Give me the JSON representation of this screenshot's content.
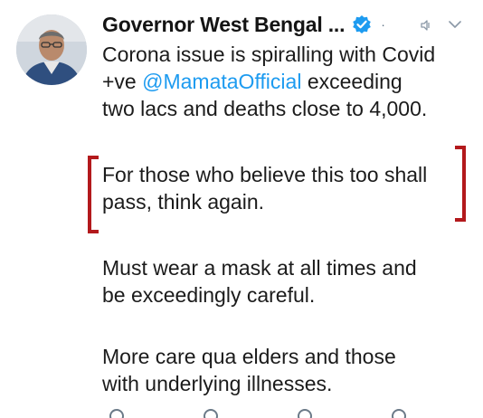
{
  "tweet": {
    "author_name": "Governor West Bengal ...",
    "separator": "·",
    "icons": {
      "avatar": "avatar",
      "verified": "verified-badge-icon",
      "mute": "mute-icon",
      "menu": "chevron-down-icon"
    },
    "paragraph1": {
      "line1": "Corona issue is spiralling with Covid",
      "line2_prefix": "+ve ",
      "mention": "@MamataOfficial",
      "line2_suffix": " exceeding",
      "line3": "two lacs and deaths close to 4,000."
    },
    "paragraph2": {
      "line1": "For those who believe this too shall",
      "line2": "pass, think again."
    },
    "paragraph3": {
      "line1": "Must wear a mask at all times and",
      "line2": "be exceedingly careful."
    },
    "paragraph4": {
      "line1": "More care qua elders and those",
      "line2": "with underlying illnesses."
    }
  },
  "colors": {
    "mention": "#1d9bf0",
    "annotation_bracket": "#b3191c",
    "verified": "#1d9bf0",
    "text": "#1b1b1b"
  }
}
